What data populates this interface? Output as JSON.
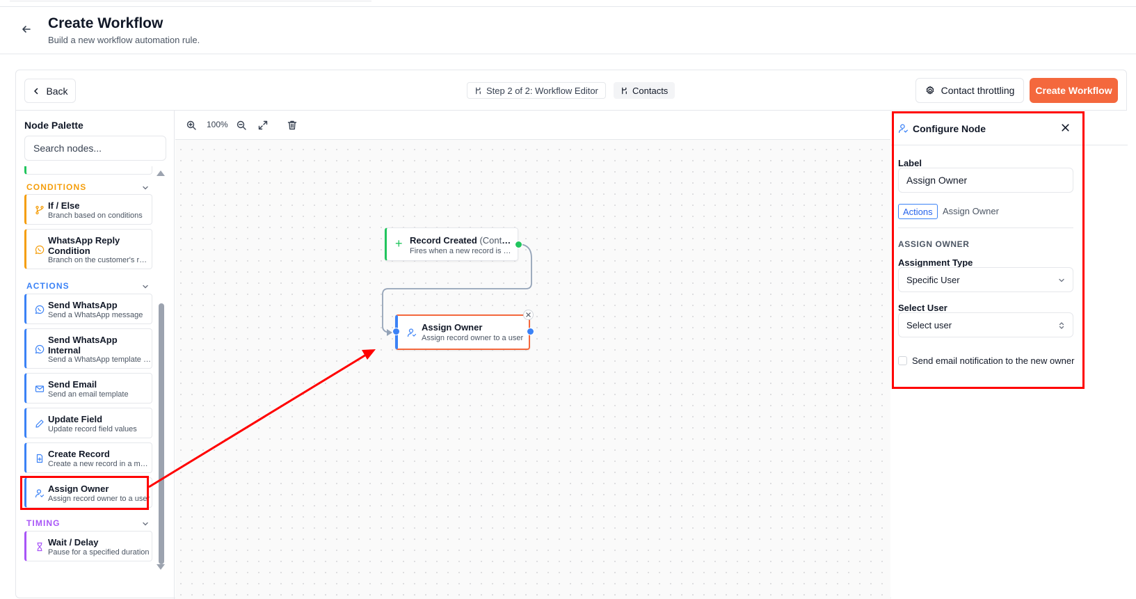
{
  "header": {
    "title": "Create Workflow",
    "subtitle": "Build a new workflow automation rule."
  },
  "toolbar": {
    "back_label": "Back",
    "step_label": "Step 2 of 2: Workflow Editor",
    "entity_label": "Contacts",
    "throttle_label": "Contact throttling",
    "create_label": "Create Workflow"
  },
  "palette": {
    "title": "Node Palette",
    "search_placeholder": "Search nodes...",
    "sections": {
      "conditions": "CONDITIONS",
      "actions": "ACTIONS",
      "timing": "TIMING"
    },
    "items": {
      "if_else": {
        "title": "If / Else",
        "desc": "Branch based on conditions"
      },
      "wa_reply": {
        "title": "WhatsApp Reply Condition",
        "desc": "Branch on the customer's reply"
      },
      "send_wa": {
        "title": "Send WhatsApp",
        "desc": "Send a WhatsApp message"
      },
      "send_wa_internal": {
        "title": "Send WhatsApp Internal",
        "desc": "Send a WhatsApp template to a user"
      },
      "send_email": {
        "title": "Send Email",
        "desc": "Send an email template"
      },
      "update_field": {
        "title": "Update Field",
        "desc": "Update record field values"
      },
      "create_record": {
        "title": "Create Record",
        "desc": "Create a new record in a module"
      },
      "assign_owner": {
        "title": "Assign Owner",
        "desc": "Assign record owner to a user"
      },
      "wait_delay": {
        "title": "Wait / Delay",
        "desc": "Pause for a specified duration"
      }
    }
  },
  "canvas": {
    "zoom": "100%",
    "nodes": {
      "trigger": {
        "title": "Record Created",
        "title_suffix": "(Contacts)",
        "desc": "Fires when a new record is created"
      },
      "assign": {
        "title": "Assign Owner",
        "desc": "Assign record owner to a user"
      }
    }
  },
  "config": {
    "title": "Configure Node",
    "label_caption": "Label",
    "label_value": "Assign Owner",
    "category_tag": "Actions",
    "node_type": "Assign Owner",
    "section_title": "ASSIGN OWNER",
    "assignment_type_caption": "Assignment Type",
    "assignment_type_value": "Specific User",
    "select_user_caption": "Select User",
    "select_user_value": "Select user",
    "notify_label": "Send email notification to the new owner",
    "notify_checked": false
  },
  "colors": {
    "accent": "#f4683d",
    "trigger": "#22c55e",
    "conditions": "#f59e0b",
    "actions": "#3b82f6",
    "timing": "#a855f7",
    "annotation": "#ff0000"
  }
}
